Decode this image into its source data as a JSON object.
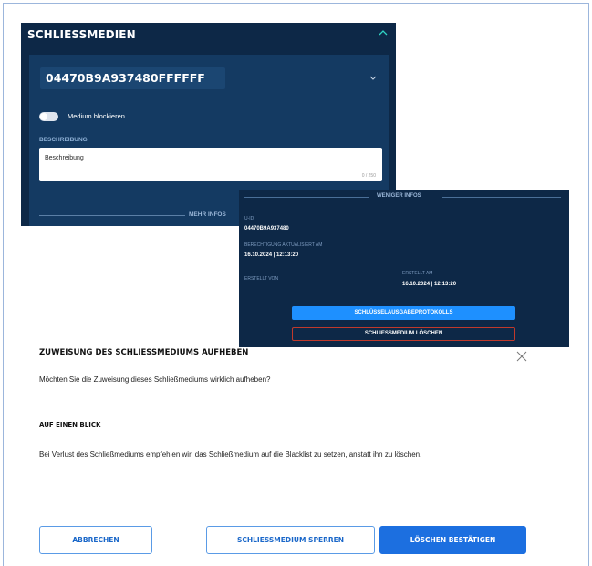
{
  "panel1": {
    "title": "SCHLIESSMEDIEN",
    "medium_id": "04470B9A937480FFFFFF",
    "toggle_label": "Medium blockieren",
    "beschreibung_label": "BESCHREIBUNG",
    "beschreibung_placeholder": "Beschreibung",
    "char_count": "0 / 250",
    "mehr_infos": "MEHR INFOS"
  },
  "panel2": {
    "weniger_infos": "WENIGER INFOS",
    "uid_label": "U-ID",
    "uid_value": "04470B9A937480",
    "berechtigung_label": "BERECHTIGUNG AKTUALISIERT AM",
    "berechtigung_value": "16.10.2024 | 12:13:20",
    "erstellt_von_label": "ERSTELLT VON",
    "erstellt_am_label": "ERSTELLT AM",
    "erstellt_am_value": "16.10.2024 | 12:13:20",
    "protokolle_button": "SCHLÜSSELAUSGABEPROTOKOLLS",
    "loeschen_button": "SCHLIESSMEDIUM LÖSCHEN"
  },
  "dialog": {
    "title": "ZUWEISUNG DES SCHLIESSMEDIUMS AUFHEBEN",
    "question": "Möchten Sie die Zuweisung dieses Schließmediums wirklich aufheben?",
    "subheading": "AUF EINEN BLICK",
    "info": "Bei Verlust des Schließmediums empfehlen wir, das Schließmedium auf die Blacklist zu setzen, anstatt ihn zu löschen.",
    "cancel_button": "ABBRECHEN",
    "block_button": "SCHLIESSMEDIUM SPERREN",
    "confirm_button": "LÖSCHEN BESTÄTIGEN"
  },
  "colors": {
    "panel_bg": "#0d2847",
    "panel_inner": "#143a62",
    "primary_blue": "#1c6fe0",
    "outline_blue": "#5a9be6",
    "danger_red": "#c0392b"
  },
  "icons": {
    "collapse": "chevron-up-icon",
    "dropdown": "chevron-down-icon",
    "close": "close-icon"
  }
}
